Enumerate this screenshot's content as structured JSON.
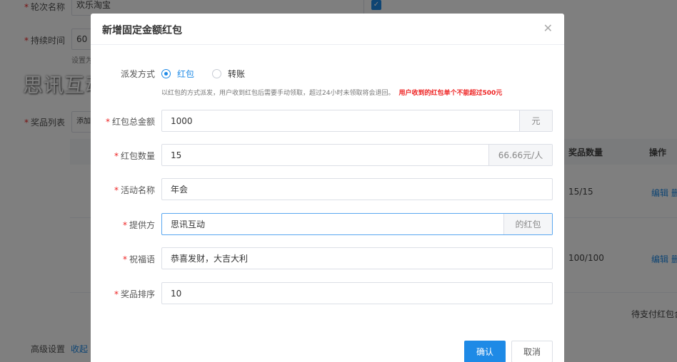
{
  "background": {
    "round_name_label": "轮次名称",
    "round_name_value": "欢乐淘宝",
    "duration_label": "持续时间",
    "duration_value": "60",
    "duration_hint": "设置为",
    "watermark": "思讯互动",
    "prize_list_label": "奖品列表",
    "add_button_label": "添加",
    "table_headers": {
      "quantity": "奖品数量",
      "action": "操作"
    },
    "rows": [
      {
        "quantity": "15/15",
        "edit": "编辑",
        "delete": "删"
      },
      {
        "quantity": "100/100",
        "edit": "编辑",
        "delete": "删"
      }
    ],
    "pending_text": "待支付红包合",
    "advanced_label": "高级设置",
    "collapse_link": "收起"
  },
  "modal": {
    "title": "新增固定金额红包",
    "close_icon": "close-icon",
    "dispatch_method_label": "派发方式",
    "dispatch_options": [
      {
        "label": "红包",
        "selected": true
      },
      {
        "label": "转账",
        "selected": false
      }
    ],
    "hint_text": "以红包的方式派发，用户收到红包后需要手动领取，超过24小时未领取将会退回。",
    "hint_warning": "用户收到的红包单个不能超过500元",
    "fields": {
      "total_amount": {
        "label": "红包总金额",
        "value": "1000",
        "suffix": "元"
      },
      "count": {
        "label": "红包数量",
        "value": "15",
        "suffix": "66.66元/人"
      },
      "activity_name": {
        "label": "活动名称",
        "value": "年会"
      },
      "provider": {
        "label": "提供方",
        "value": "思讯互动",
        "suffix": "的红包"
      },
      "blessing": {
        "label": "祝福语",
        "value": "恭喜发财，大吉大利"
      },
      "sort_order": {
        "label": "奖品排序",
        "value": "10"
      }
    },
    "required_mark": "*",
    "confirm_label": "确认",
    "cancel_label": "取消"
  },
  "colors": {
    "accent": "#1e8ae6",
    "warning": "#e22222",
    "overlay": "rgba(0,0,0,0.5)"
  }
}
